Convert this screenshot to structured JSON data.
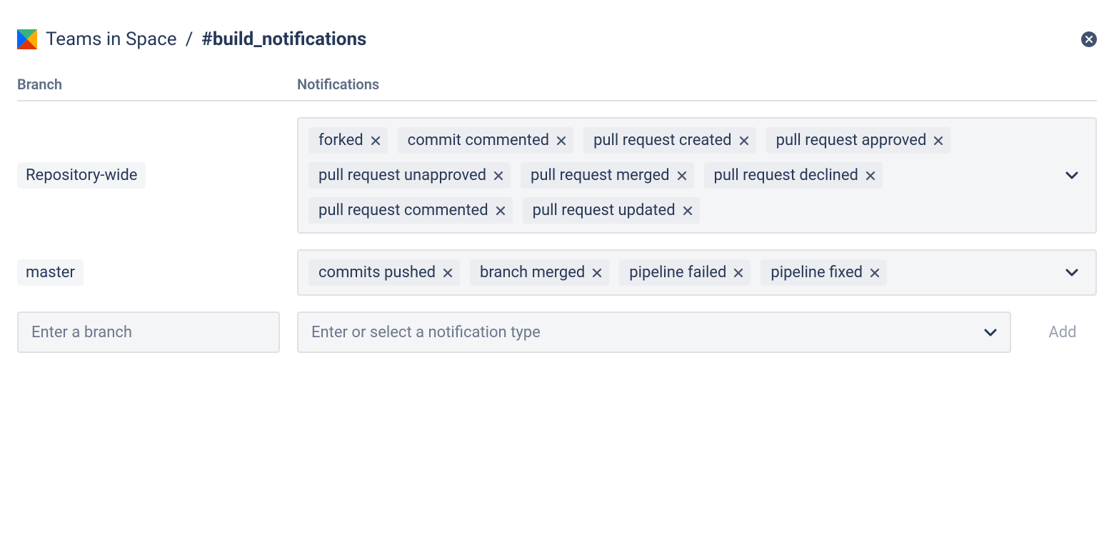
{
  "header": {
    "project": "Teams in Space",
    "separator": "/",
    "channel": "#build_notifications"
  },
  "columns": {
    "branch": "Branch",
    "notifications": "Notifications"
  },
  "rows": [
    {
      "branch_label": "Repository-wide",
      "tags": [
        "forked",
        "commit commented",
        "pull request created",
        "pull request approved",
        "pull request unapproved",
        "pull request merged",
        "pull request declined",
        "pull request commented",
        "pull request updated"
      ]
    },
    {
      "branch_label": "master",
      "tags": [
        "commits pushed",
        "branch merged",
        "pipeline failed",
        "pipeline fixed"
      ]
    }
  ],
  "inputs": {
    "branch_placeholder": "Enter a branch",
    "notification_placeholder": "Enter or select a notification type",
    "add_label": "Add"
  },
  "colors": {
    "text_primary": "#172B4D",
    "text_muted": "#5E6C84",
    "pill_bg": "#F4F5F7",
    "tag_bg": "#ECEDF0",
    "border": "#DFE1E6"
  }
}
